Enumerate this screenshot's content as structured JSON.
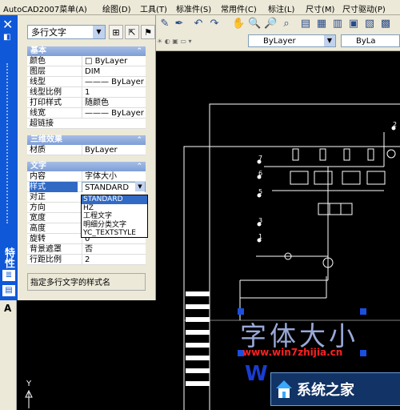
{
  "menu": [
    "AutoCAD2007菜单(A)",
    "绘图(D)",
    "工具(T)",
    "标准件(S)",
    "常用件(C)",
    "标注(L)",
    "尺寸(M)",
    "尺寸驱动(P)"
  ],
  "toolbar2": {
    "layer_combo": "ByLayer",
    "color_combo": "ByLayer",
    "linetype_combo": "ByLa"
  },
  "panel": {
    "title": "特性",
    "object_type": "多行文字",
    "sections": {
      "basic": {
        "label": "基本",
        "rows": [
          {
            "k": "颜色",
            "v": "□ ByLayer"
          },
          {
            "k": "图层",
            "v": "DIM"
          },
          {
            "k": "线型",
            "v": "——— ByLayer"
          },
          {
            "k": "线型比例",
            "v": "1"
          },
          {
            "k": "打印样式",
            "v": "随颜色"
          },
          {
            "k": "线宽",
            "v": "——— ByLayer"
          },
          {
            "k": "超链接",
            "v": ""
          }
        ]
      },
      "threed": {
        "label": "三维效果",
        "rows": [
          {
            "k": "材质",
            "v": "ByLayer"
          }
        ]
      },
      "text": {
        "label": "文字",
        "rows": [
          {
            "k": "内容",
            "v": "字体大小"
          },
          {
            "k": "样式",
            "v": "STANDARD"
          },
          {
            "k": "对正",
            "v": ""
          },
          {
            "k": "方向",
            "v": ""
          },
          {
            "k": "宽度",
            "v": ""
          },
          {
            "k": "高度",
            "v": ""
          },
          {
            "k": "旋转",
            "v": "0"
          },
          {
            "k": "背景遮罩",
            "v": "否"
          },
          {
            "k": "行距比例",
            "v": "2"
          }
        ]
      }
    },
    "style_options": [
      "STANDARD",
      "HZ",
      "工程文字",
      "明细分类文字",
      "YC_TEXTSTYLE"
    ],
    "status": "指定多行文字的样式名"
  },
  "left_tab_label": "A",
  "canvas": {
    "ucs_label": "Y",
    "mtext_content": "字体大小",
    "watermark_url": "www.win7zhijia.cn",
    "logo_text": "系统之家",
    "watermark_big": "W",
    "port_labels": [
      "7",
      "6",
      "5",
      "3",
      "1",
      "2"
    ]
  },
  "colors": {
    "panel_bg": "#ECE9D8",
    "canvas_bg": "#000000",
    "strip": "#0F58D8",
    "selection": "#316AC5",
    "grip": "#1A4FE0",
    "watermark": "#FF2020"
  }
}
